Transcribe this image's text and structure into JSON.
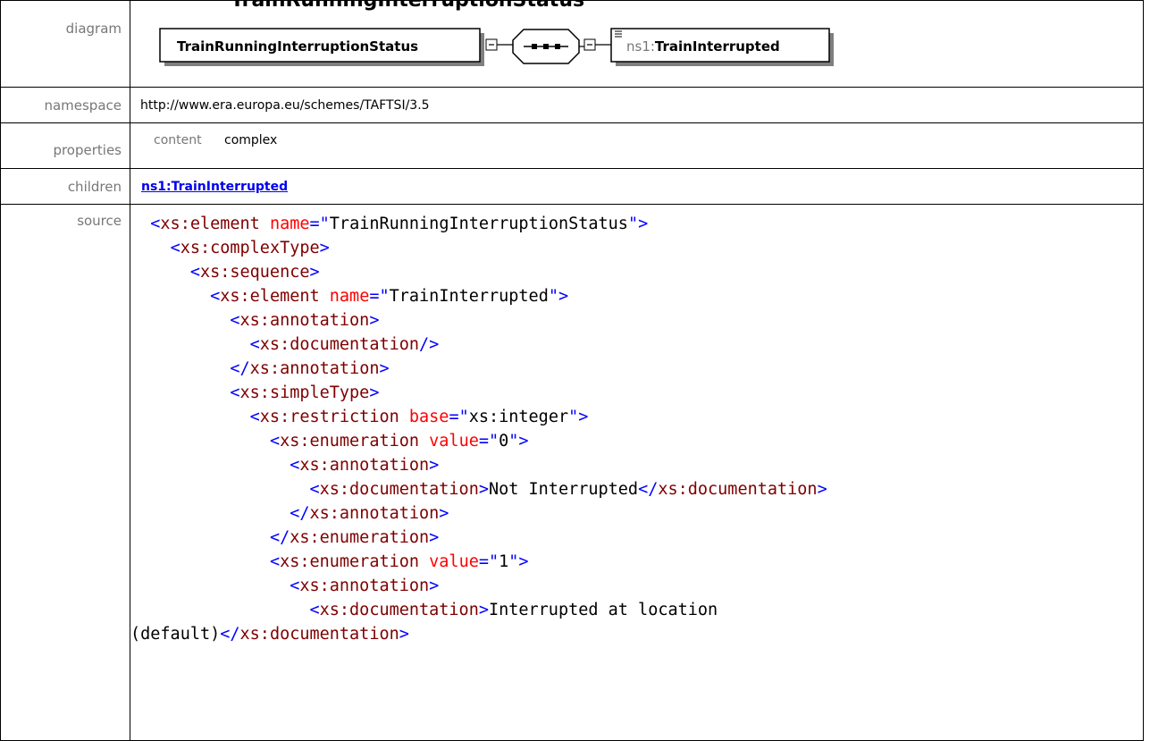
{
  "heading": "TrainRunningInterruptionStatus",
  "rows": {
    "diagram": {
      "label": "diagram"
    },
    "namespace": {
      "label": "namespace",
      "value": "http://www.era.europa.eu/schemes/TAFTSI/3.5"
    },
    "properties": {
      "label": "properties",
      "key": "content",
      "value": "complex"
    },
    "children": {
      "label": "children",
      "link": "ns1:TrainInterrupted"
    },
    "source": {
      "label": "source"
    }
  },
  "diagram": {
    "main_element": "TrainRunningInterruptionStatus",
    "child_prefix": "ns1:",
    "child_name": "TrainInterrupted"
  },
  "source_lines": [
    [
      "0",
      [
        [
          "p",
          "<"
        ],
        [
          "t",
          "xs:element"
        ],
        [
          "v",
          " "
        ],
        [
          "a",
          "name"
        ],
        [
          "p",
          "=\""
        ],
        [
          "v",
          "TrainRunningInterruptionStatus"
        ],
        [
          "p",
          "\">"
        ]
      ]
    ],
    [
      "1",
      [
        [
          "p",
          "<"
        ],
        [
          "t",
          "xs:complexType"
        ],
        [
          "p",
          ">"
        ]
      ]
    ],
    [
      "2",
      [
        [
          "p",
          "<"
        ],
        [
          "t",
          "xs:sequence"
        ],
        [
          "p",
          ">"
        ]
      ]
    ],
    [
      "3",
      [
        [
          "p",
          "<"
        ],
        [
          "t",
          "xs:element"
        ],
        [
          "v",
          " "
        ],
        [
          "a",
          "name"
        ],
        [
          "p",
          "=\""
        ],
        [
          "v",
          "TrainInterrupted"
        ],
        [
          "p",
          "\">"
        ]
      ]
    ],
    [
      "4",
      [
        [
          "p",
          "<"
        ],
        [
          "t",
          "xs:annotation"
        ],
        [
          "p",
          ">"
        ]
      ]
    ],
    [
      "5",
      [
        [
          "p",
          "<"
        ],
        [
          "t",
          "xs:documentation"
        ],
        [
          "p",
          "/>"
        ]
      ]
    ],
    [
      "4",
      [
        [
          "p",
          "</"
        ],
        [
          "t",
          "xs:annotation"
        ],
        [
          "p",
          ">"
        ]
      ]
    ],
    [
      "4",
      [
        [
          "p",
          "<"
        ],
        [
          "t",
          "xs:simpleType"
        ],
        [
          "p",
          ">"
        ]
      ]
    ],
    [
      "5",
      [
        [
          "p",
          "<"
        ],
        [
          "t",
          "xs:restriction"
        ],
        [
          "v",
          " "
        ],
        [
          "a",
          "base"
        ],
        [
          "p",
          "=\""
        ],
        [
          "v",
          "xs:integer"
        ],
        [
          "p",
          "\">"
        ]
      ]
    ],
    [
      "6",
      [
        [
          "p",
          "<"
        ],
        [
          "t",
          "xs:enumeration"
        ],
        [
          "v",
          " "
        ],
        [
          "a",
          "value"
        ],
        [
          "p",
          "=\""
        ],
        [
          "v",
          "0"
        ],
        [
          "p",
          "\">"
        ]
      ]
    ],
    [
      "7",
      [
        [
          "p",
          "<"
        ],
        [
          "t",
          "xs:annotation"
        ],
        [
          "p",
          ">"
        ]
      ]
    ],
    [
      "8",
      [
        [
          "p",
          "<"
        ],
        [
          "t",
          "xs:documentation"
        ],
        [
          "p",
          ">"
        ],
        [
          "v",
          "Not Interrupted"
        ],
        [
          "p",
          "</"
        ],
        [
          "t",
          "xs:documentation"
        ],
        [
          "p",
          ">"
        ]
      ]
    ],
    [
      "7",
      [
        [
          "p",
          "</"
        ],
        [
          "t",
          "xs:annotation"
        ],
        [
          "p",
          ">"
        ]
      ]
    ],
    [
      "6",
      [
        [
          "p",
          "</"
        ],
        [
          "t",
          "xs:enumeration"
        ],
        [
          "p",
          ">"
        ]
      ]
    ],
    [
      "6",
      [
        [
          "p",
          "<"
        ],
        [
          "t",
          "xs:enumeration"
        ],
        [
          "v",
          " "
        ],
        [
          "a",
          "value"
        ],
        [
          "p",
          "=\""
        ],
        [
          "v",
          "1"
        ],
        [
          "p",
          "\">"
        ]
      ]
    ],
    [
      "7",
      [
        [
          "p",
          "<"
        ],
        [
          "t",
          "xs:annotation"
        ],
        [
          "p",
          ">"
        ]
      ]
    ],
    [
      "8",
      [
        [
          "p",
          "<"
        ],
        [
          "t",
          "xs:documentation"
        ],
        [
          "p",
          ">"
        ],
        [
          "v",
          "Interrupted at location"
        ]
      ]
    ],
    [
      "-",
      [
        [
          "v",
          "(default)"
        ],
        [
          "p",
          "</"
        ],
        [
          "t",
          "xs:documentation"
        ],
        [
          "p",
          ">"
        ]
      ]
    ]
  ]
}
